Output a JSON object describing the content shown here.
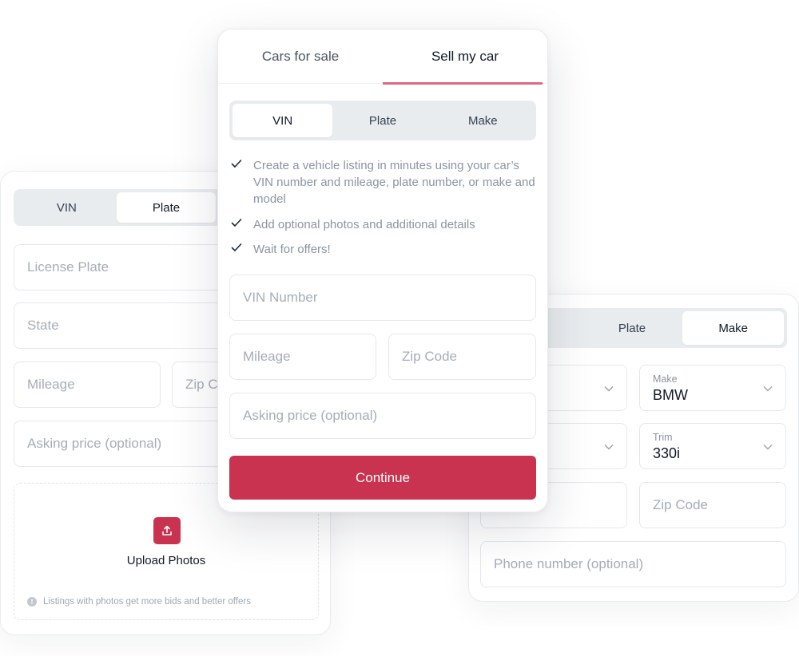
{
  "colors": {
    "accent": "#c9334f",
    "tab_underline": "#de6a80",
    "segment_bg": "#e9ecef",
    "placeholder": "#a6adb8"
  },
  "left_card": {
    "segments": [
      {
        "label": "VIN",
        "active": false
      },
      {
        "label": "Plate",
        "active": true
      }
    ],
    "fields": {
      "license_plate": "License Plate",
      "state": "State",
      "mileage": "Mileage",
      "zip_code": "Zip C",
      "asking_price": "Asking price (optional)"
    },
    "upload": {
      "icon": "upload-icon",
      "title": "Upload Photos",
      "note_icon": "info-icon",
      "note": "Listings with photos get more bids and better offers"
    }
  },
  "front_card": {
    "tabs": [
      {
        "label": "Cars for sale",
        "active": false
      },
      {
        "label": "Sell my car",
        "active": true
      }
    ],
    "segments": [
      {
        "label": "VIN",
        "active": true
      },
      {
        "label": "Plate",
        "active": false
      },
      {
        "label": "Make",
        "active": false
      }
    ],
    "checklist": [
      "Create a vehicle listing in minutes using your car’s VIN number and mileage, plate number, or make and model",
      "Add optional photos and additional details",
      "Wait for offers!"
    ],
    "fields": {
      "vin_number": "VIN Number",
      "mileage": "Mileage",
      "zip_code": "Zip Code",
      "asking_price": "Asking price (optional)"
    },
    "continue_label": "Continue"
  },
  "right_card": {
    "segments": [
      {
        "label": "Plate",
        "active": false
      },
      {
        "label": "Make",
        "active": true
      }
    ],
    "selects": {
      "make": {
        "label": "Make",
        "value": "BMW"
      },
      "trim": {
        "label": "Trim",
        "value": "330i"
      }
    },
    "fields": {
      "zip_code": "Zip Code",
      "phone": "Phone number (optional)"
    }
  }
}
